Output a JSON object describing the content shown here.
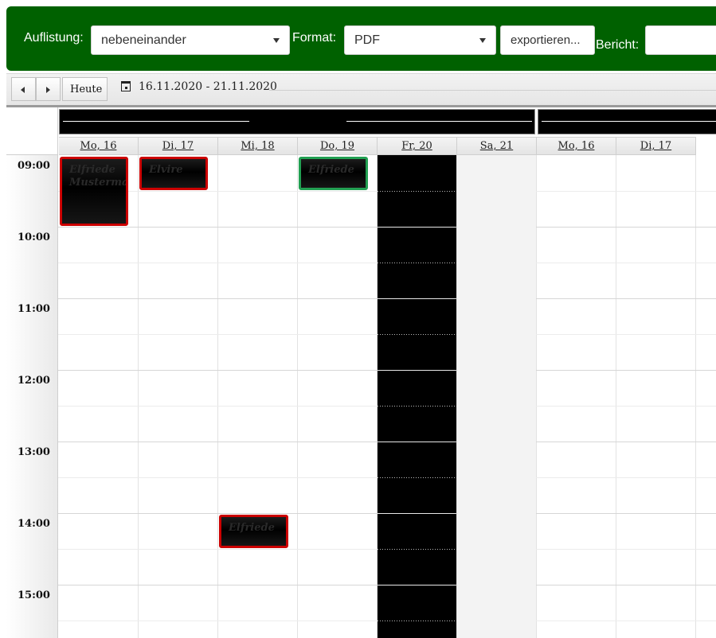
{
  "toolbar": {
    "listing_label": "Auflistung:",
    "listing_value": "nebeneinander",
    "format_label": "Format:",
    "format_value": "PDF",
    "export_label": "exportieren...",
    "report_label": "Bericht:",
    "report_value": "",
    "colors": {
      "background": "#006100"
    }
  },
  "nav": {
    "prev_icon": "triangle-left-icon",
    "next_icon": "triangle-right-icon",
    "today_label": "Heute",
    "calendar_icon": "calendar-icon",
    "range": "16.11.2020 - 21.11.2020"
  },
  "days": [
    {
      "label": "Mo, 16"
    },
    {
      "label": "Di, 17"
    },
    {
      "label": "Mi, 18"
    },
    {
      "label": "Do, 19"
    },
    {
      "label": "Fr, 20"
    },
    {
      "label": "Sa, 21"
    },
    {
      "label": "Mo, 16"
    },
    {
      "label": "Di, 17"
    }
  ],
  "times": [
    "09:00",
    "10:00",
    "11:00",
    "12:00",
    "13:00",
    "14:00",
    "15:00"
  ],
  "events": [
    {
      "title": "Elfriede\nMusterma",
      "day": "Mo, 16",
      "time": "09:00",
      "status": "red"
    },
    {
      "title": "Elvire",
      "day": "Di, 17",
      "time": "09:00",
      "status": "red"
    },
    {
      "title": "Elfriede",
      "day": "Do, 19",
      "time": "09:00",
      "status": "green"
    },
    {
      "title": "Elfriede",
      "day": "Mi, 18",
      "time": "14:00",
      "status": "red"
    }
  ],
  "colors": {
    "event_red": "#cc0000",
    "event_green": "#22a052",
    "blocked_day": "#000000",
    "weekend": "#f3f3f3"
  }
}
